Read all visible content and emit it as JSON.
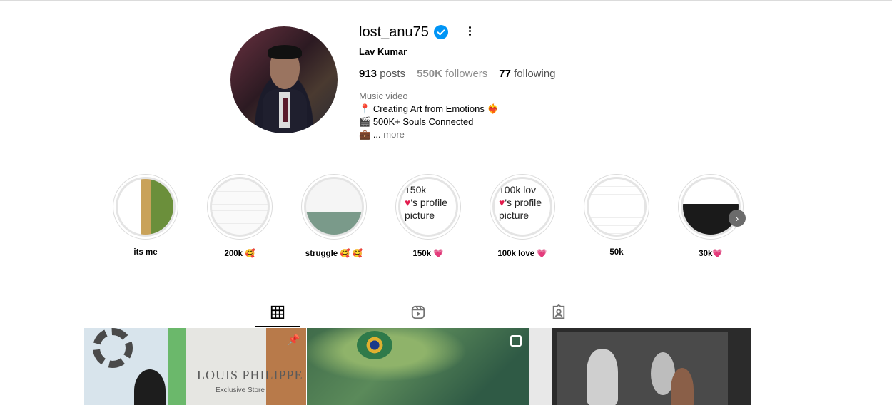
{
  "profile": {
    "username": "lost_anu75",
    "full_name": "Lav Kumar",
    "verified": true,
    "stats": {
      "posts_count": "913",
      "posts_label": "posts",
      "followers_count": "550K",
      "followers_label": "followers",
      "following_count": "77",
      "following_label": "following"
    },
    "bio": {
      "category": "Music video",
      "line1_icon": "📍",
      "line1_text": "Creating Art from Emotions",
      "line1_emoji": "❤️‍🔥",
      "line2_icon": "🎬",
      "line2_text": "500K+ Souls Connected",
      "line3_icon": "💼",
      "line3_text": "...",
      "more_label": "more"
    }
  },
  "highlights": [
    {
      "label": "its me",
      "alt": ""
    },
    {
      "label": "200k 🥰",
      "alt": ""
    },
    {
      "label": "struggle 🥰 🥰",
      "alt": ""
    },
    {
      "label": "150k 💗",
      "alt_line1": "150k",
      "alt_line2": "'s profile",
      "alt_line3": "picture"
    },
    {
      "label": "100k love 💗",
      "alt_line1": "100k lov",
      "alt_line2": "'s profile",
      "alt_line3": "picture"
    },
    {
      "label": "50k",
      "alt": ""
    },
    {
      "label": "30k💗",
      "alt": ""
    }
  ],
  "tabs": [
    {
      "name": "posts",
      "icon": "grid-icon",
      "active": true
    },
    {
      "name": "reels",
      "icon": "reels-icon",
      "active": false
    },
    {
      "name": "tagged",
      "icon": "tagged-icon",
      "active": false
    }
  ],
  "posts": [
    {
      "brand_text": "LOUIS PHILIPPE",
      "brand_sub": "Exclusive Store",
      "badge": "pin-icon"
    },
    {
      "badge": "multiple-icon"
    },
    {
      "badge": ""
    }
  ],
  "colors": {
    "verified": "#0095f6",
    "muted": "#737373",
    "heart": "#e21b4d"
  }
}
